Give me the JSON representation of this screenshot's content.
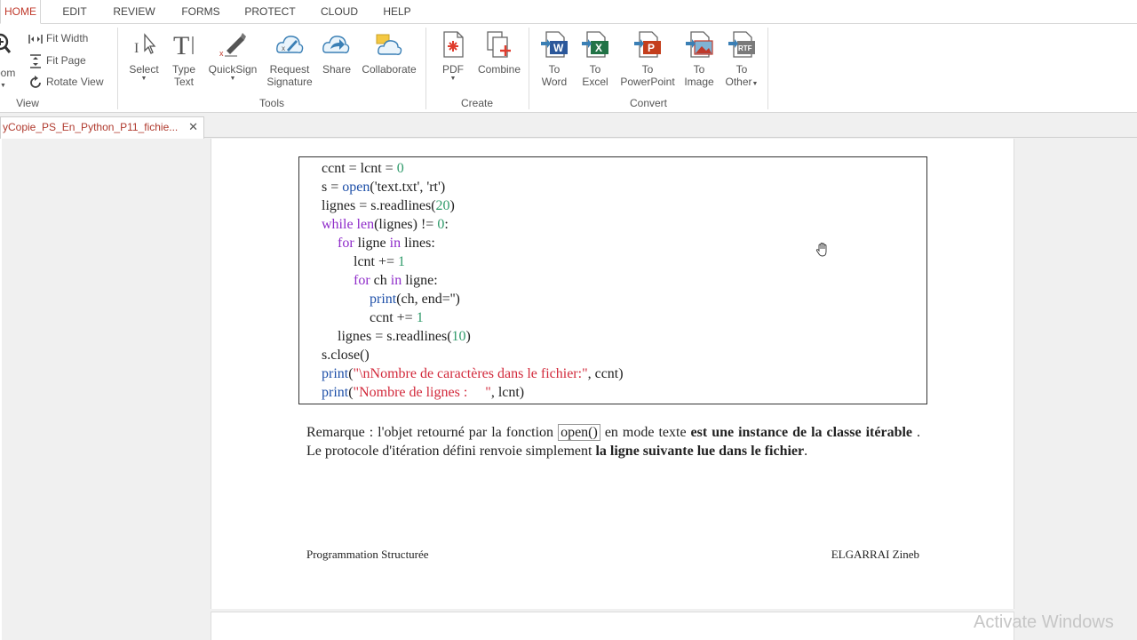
{
  "menu": {
    "tabs": [
      {
        "label": "HOME",
        "active": true
      },
      {
        "label": "EDIT"
      },
      {
        "label": "REVIEW"
      },
      {
        "label": "FORMS"
      },
      {
        "label": "PROTECT"
      },
      {
        "label": "CLOUD"
      },
      {
        "label": "HELP"
      }
    ]
  },
  "ribbon": {
    "view": {
      "zoom_label": "oom",
      "fit_width": "Fit Width",
      "fit_page": "Fit Page",
      "rotate_view": "Rotate View",
      "group_label": "View"
    },
    "tools": {
      "select": "Select",
      "type_text_1": "Type",
      "type_text_2": "Text",
      "quicksign": "QuickSign",
      "request_signature_1": "Request",
      "request_signature_2": "Signature",
      "share": "Share",
      "collaborate": "Collaborate",
      "group_label": "Tools"
    },
    "create": {
      "pdf": "PDF",
      "combine": "Combine",
      "group_label": "Create"
    },
    "convert": {
      "to_word_1": "To",
      "to_word_2": "Word",
      "to_excel_1": "To",
      "to_excel_2": "Excel",
      "to_powerpoint_1": "To",
      "to_powerpoint_2": "PowerPoint",
      "to_image_1": "To",
      "to_image_2": "Image",
      "to_other_1": "To",
      "to_other_2": "Other",
      "group_label": "Convert"
    }
  },
  "document_tab": {
    "title": "yCopie_PS_En_Python_P11_fichie...",
    "close": "✕"
  },
  "document": {
    "code_lines": [
      {
        "indent": 0,
        "parts": [
          {
            "t": "ccnt = lcnt = ",
            "c": ""
          },
          {
            "t": "0",
            "c": "num"
          }
        ]
      },
      {
        "indent": 0,
        "parts": [
          {
            "t": "s = ",
            "c": ""
          },
          {
            "t": "open",
            "c": "bi"
          },
          {
            "t": "(",
            "c": ""
          },
          {
            "t": "'text.txt'",
            "c": ""
          },
          {
            "t": ", ",
            "c": ""
          },
          {
            "t": "'rt'",
            "c": ""
          },
          {
            "t": ")",
            "c": ""
          }
        ]
      },
      {
        "indent": 0,
        "parts": [
          {
            "t": "lignes = s.readlines(",
            "c": ""
          },
          {
            "t": "20",
            "c": "num"
          },
          {
            "t": ")",
            "c": ""
          }
        ]
      },
      {
        "indent": 0,
        "parts": [
          {
            "t": "while ",
            "c": "kw"
          },
          {
            "t": "len",
            "c": "kw"
          },
          {
            "t": "(lignes) != ",
            "c": ""
          },
          {
            "t": "0",
            "c": "num"
          },
          {
            "t": ":",
            "c": ""
          }
        ]
      },
      {
        "indent": 1,
        "parts": [
          {
            "t": "for ",
            "c": "kw"
          },
          {
            "t": "ligne ",
            "c": ""
          },
          {
            "t": "in ",
            "c": "kw"
          },
          {
            "t": "lines:",
            "c": ""
          }
        ]
      },
      {
        "indent": 2,
        "parts": [
          {
            "t": "lcnt += ",
            "c": ""
          },
          {
            "t": "1",
            "c": "num"
          }
        ]
      },
      {
        "indent": 2,
        "parts": [
          {
            "t": "for ",
            "c": "kw"
          },
          {
            "t": "ch ",
            "c": ""
          },
          {
            "t": "in ",
            "c": "kw"
          },
          {
            "t": "ligne:",
            "c": ""
          }
        ]
      },
      {
        "indent": 3,
        "parts": [
          {
            "t": "print",
            "c": "bi"
          },
          {
            "t": "(ch, end='')",
            "c": ""
          }
        ]
      },
      {
        "indent": 3,
        "parts": [
          {
            "t": "ccnt += ",
            "c": ""
          },
          {
            "t": "1",
            "c": "num"
          }
        ]
      },
      {
        "indent": 1,
        "parts": [
          {
            "t": "lignes = s.readlines(",
            "c": ""
          },
          {
            "t": "10",
            "c": "num"
          },
          {
            "t": ")",
            "c": ""
          }
        ]
      },
      {
        "indent": 0,
        "parts": [
          {
            "t": "s.close()",
            "c": ""
          }
        ]
      },
      {
        "indent": 0,
        "parts": [
          {
            "t": "print",
            "c": "bi"
          },
          {
            "t": "(",
            "c": ""
          },
          {
            "t": "\"\\nNombre de caractères dans le fichier:\"",
            "c": "str"
          },
          {
            "t": ", ccnt)",
            "c": ""
          }
        ]
      },
      {
        "indent": 0,
        "parts": [
          {
            "t": "print",
            "c": "bi"
          },
          {
            "t": "(",
            "c": ""
          },
          {
            "t": "\"Nombre de lignes :     \"",
            "c": "str"
          },
          {
            "t": ", lcnt)",
            "c": ""
          }
        ]
      }
    ],
    "remark": {
      "p1": "Remarque : l'objet retourné par la fonction ",
      "code": "open()",
      "p2": " en mode texte ",
      "b1": "est une instance de la classe itérable",
      "p3": " . Le protocole d'itération défini renvoie simplement ",
      "b2": "la ligne suivante lue dans le fichier",
      "p4": "."
    },
    "footer_left": "Programmation Structurée",
    "footer_right": "ELGARRAI  Zineb"
  },
  "watermark": "Activate Windows",
  "colors": {
    "accent": "#c0392b",
    "keyword": "#8e2bc9",
    "builtin": "#1d4fa8",
    "number": "#2f9a6a",
    "string": "#d2293b"
  }
}
